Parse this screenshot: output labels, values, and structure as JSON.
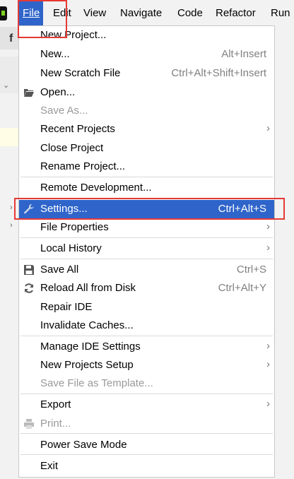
{
  "menubar": {
    "items": [
      "File",
      "Edit",
      "View",
      "Navigate",
      "Code",
      "Refactor",
      "Run"
    ],
    "active": "File"
  },
  "left_panel": {
    "text": "f"
  },
  "file_menu": {
    "items": [
      {
        "label": "New Project...",
        "shortcut": "",
        "submenu": false,
        "disabled": false,
        "icon": ""
      },
      {
        "label": "New...",
        "shortcut": "Alt+Insert",
        "submenu": false,
        "disabled": false,
        "icon": ""
      },
      {
        "label": "New Scratch File",
        "shortcut": "Ctrl+Alt+Shift+Insert",
        "submenu": false,
        "disabled": false,
        "icon": ""
      },
      {
        "label": "Open...",
        "shortcut": "",
        "submenu": false,
        "disabled": false,
        "icon": "folder-icon"
      },
      {
        "label": "Save As...",
        "shortcut": "",
        "submenu": false,
        "disabled": true,
        "icon": ""
      },
      {
        "label": "Recent Projects",
        "shortcut": "",
        "submenu": true,
        "disabled": false,
        "icon": ""
      },
      {
        "label": "Close Project",
        "shortcut": "",
        "submenu": false,
        "disabled": false,
        "icon": ""
      },
      {
        "label": "Rename Project...",
        "shortcut": "",
        "submenu": false,
        "disabled": false,
        "icon": ""
      },
      {
        "label": "Remote Development...",
        "shortcut": "",
        "submenu": false,
        "disabled": false,
        "icon": ""
      },
      {
        "label": "Settings...",
        "shortcut": "Ctrl+Alt+S",
        "submenu": false,
        "disabled": false,
        "icon": "wrench-icon",
        "selected": true
      },
      {
        "label": "File Properties",
        "shortcut": "",
        "submenu": true,
        "disabled": false,
        "icon": ""
      },
      {
        "label": "Local History",
        "shortcut": "",
        "submenu": true,
        "disabled": false,
        "icon": ""
      },
      {
        "label": "Save All",
        "shortcut": "Ctrl+S",
        "submenu": false,
        "disabled": false,
        "icon": "save-icon"
      },
      {
        "label": "Reload All from Disk",
        "shortcut": "Ctrl+Alt+Y",
        "submenu": false,
        "disabled": false,
        "icon": "reload-icon"
      },
      {
        "label": "Repair IDE",
        "shortcut": "",
        "submenu": false,
        "disabled": false,
        "icon": ""
      },
      {
        "label": "Invalidate Caches...",
        "shortcut": "",
        "submenu": false,
        "disabled": false,
        "icon": ""
      },
      {
        "label": "Manage IDE Settings",
        "shortcut": "",
        "submenu": true,
        "disabled": false,
        "icon": ""
      },
      {
        "label": "New Projects Setup",
        "shortcut": "",
        "submenu": true,
        "disabled": false,
        "icon": ""
      },
      {
        "label": "Save File as Template...",
        "shortcut": "",
        "submenu": false,
        "disabled": true,
        "icon": ""
      },
      {
        "label": "Export",
        "shortcut": "",
        "submenu": true,
        "disabled": false,
        "icon": ""
      },
      {
        "label": "Print...",
        "shortcut": "",
        "submenu": false,
        "disabled": true,
        "icon": "printer-icon"
      },
      {
        "label": "Power Save Mode",
        "shortcut": "",
        "submenu": false,
        "disabled": false,
        "icon": ""
      },
      {
        "label": "Exit",
        "shortcut": "",
        "submenu": false,
        "disabled": false,
        "icon": ""
      }
    ]
  },
  "colors": {
    "accent": "#2f65ca",
    "highlight_box": "#e53935",
    "disabled_text": "#999999"
  }
}
